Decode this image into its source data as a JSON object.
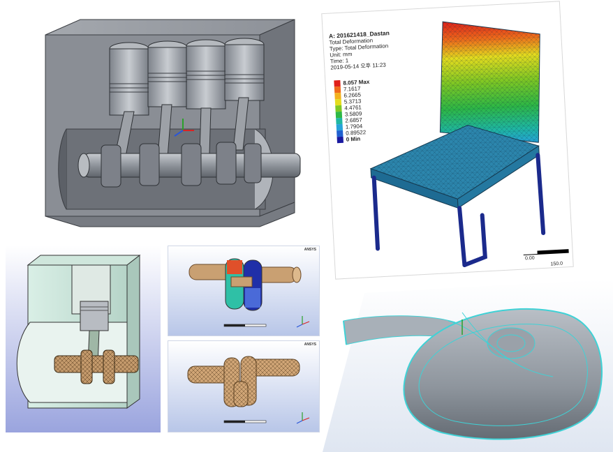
{
  "panels": {
    "engine_block": {
      "name": "four-cylinder engine block cutaway"
    },
    "chair": {
      "header": {
        "model": "A: 201621418_Dastan",
        "result": "Total Deformation",
        "type": "Type: Total Deformation",
        "unit": "Unit: mm",
        "time": "Time: 1",
        "date": "2019-05-14 오후 11:23"
      },
      "legend": [
        {
          "label": "8.057 Max",
          "color": "#e0201a"
        },
        {
          "label": "7.1617",
          "color": "#f06a1a"
        },
        {
          "label": "6.2665",
          "color": "#f3b21e"
        },
        {
          "label": "5.3713",
          "color": "#e4dc1e"
        },
        {
          "label": "4.4761",
          "color": "#7ec823"
        },
        {
          "label": "3.5809",
          "color": "#2eb845"
        },
        {
          "label": "2.6857",
          "color": "#1fb7a2"
        },
        {
          "label": "1.7904",
          "color": "#26a3d9"
        },
        {
          "label": "0.89522",
          "color": "#2060d0"
        },
        {
          "label": "0 Min",
          "color": "#1a1aa0"
        }
      ],
      "scale": {
        "left": "0.00",
        "right": "150.0"
      }
    },
    "single_cylinder": {
      "name": "single cylinder meshed crankshaft"
    },
    "crank_top": {
      "logo": "ANSYS"
    },
    "crank_bottom": {
      "logo": "ANSYS"
    },
    "rock": {
      "name": "wireframe surface model"
    }
  },
  "colors": {
    "gray_model": "#8a8f96",
    "gray_dark": "#5b6068",
    "ansys_bg_top": "#ffffff",
    "ansys_bg_bottom": "#b8c6e8",
    "mesh_tan": "#c49a6c",
    "cyan_edge": "#3fd2d6"
  }
}
